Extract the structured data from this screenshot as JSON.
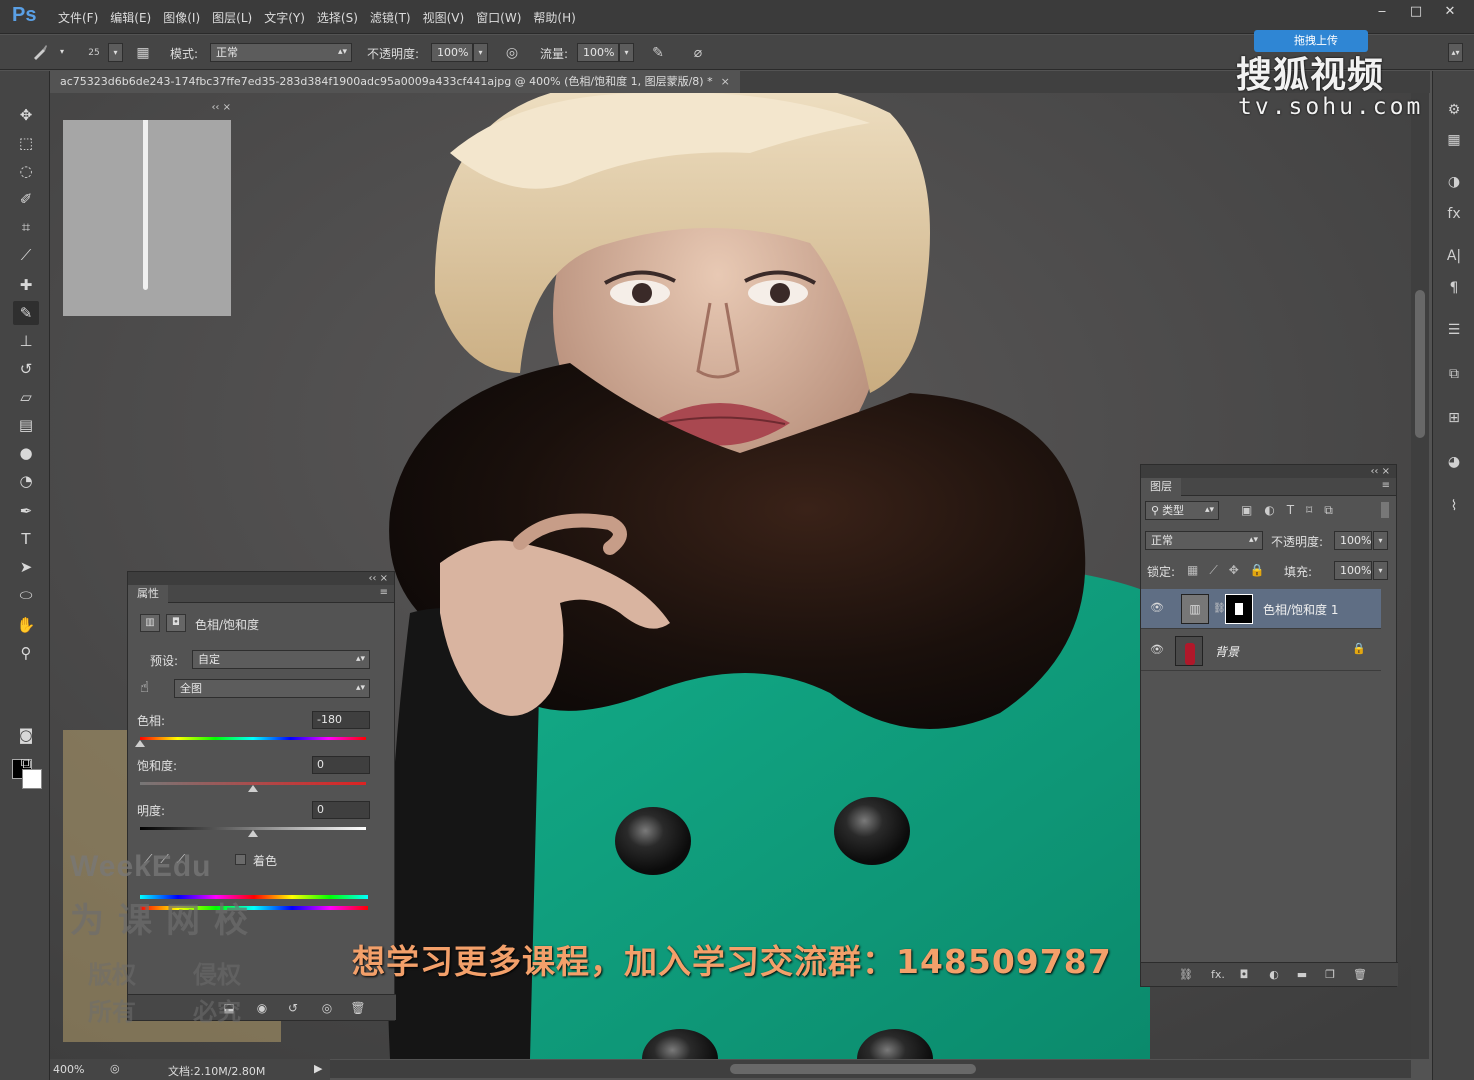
{
  "app": {
    "logo": "Ps"
  },
  "menu": [
    "文件(F)",
    "编辑(E)",
    "图像(I)",
    "图层(L)",
    "文字(Y)",
    "选择(S)",
    "滤镜(T)",
    "视图(V)",
    "窗口(W)",
    "帮助(H)"
  ],
  "window_controls": [
    "‒",
    "□",
    "✕"
  ],
  "options": {
    "brush_size": "25",
    "mode_label": "模式:",
    "mode_value": "正常",
    "opacity_label": "不透明度:",
    "opacity_value": "100%",
    "flow_label": "流量:",
    "flow_value": "100%"
  },
  "document": {
    "tab_title": "ac75323d6b6de243-174fbc37ffe7ed35-283d384f1900adc95a0009a433cf441ajpg @ 400% (色相/饱和度 1, 图层蒙版/8) *",
    "tab_close": "×"
  },
  "properties": {
    "panel_title": "属性",
    "adjustment_name": "色相/饱和度",
    "preset_label": "预设:",
    "preset_value": "自定",
    "range_value": "全图",
    "hue_label": "色相:",
    "hue_value": "-180",
    "saturation_label": "饱和度:",
    "saturation_value": "0",
    "lightness_label": "明度:",
    "lightness_value": "0",
    "colorize_label": "着色",
    "hue_slider_position": 0.0,
    "saturation_slider_position": 0.5,
    "lightness_slider_position": 0.5
  },
  "layers": {
    "panel_title": "图层",
    "filter_label": "类型",
    "blend_mode": "正常",
    "opacity_label": "不透明度:",
    "opacity_value": "100%",
    "lock_label": "锁定:",
    "fill_label": "填充:",
    "fill_value": "100%",
    "items": [
      {
        "name": "色相/饱和度 1",
        "selected": true
      },
      {
        "name": "背景",
        "selected": false,
        "locked": true
      }
    ],
    "footer_fx": "fx."
  },
  "status": {
    "zoom": "400%",
    "doc_info": "文档:2.10M/2.80M"
  },
  "watermark": {
    "brand": "WeekEdu",
    "school": "为课网校",
    "line1a": "版权",
    "line1b": "侵权",
    "line2a": "所有",
    "line2b": "必究"
  },
  "sohu": {
    "upload_label": "拖拽上传",
    "logo": "搜狐视频",
    "url": "tv.sohu.com"
  },
  "subtitle": "想学习更多课程，加入学习交流群：148509787",
  "colors": {
    "chrome_dark": "#3b3b3b",
    "panel": "#535353",
    "selected_layer": "#5f6e84",
    "subtitle": "#f3a06a",
    "coat": "#0f9a79"
  }
}
